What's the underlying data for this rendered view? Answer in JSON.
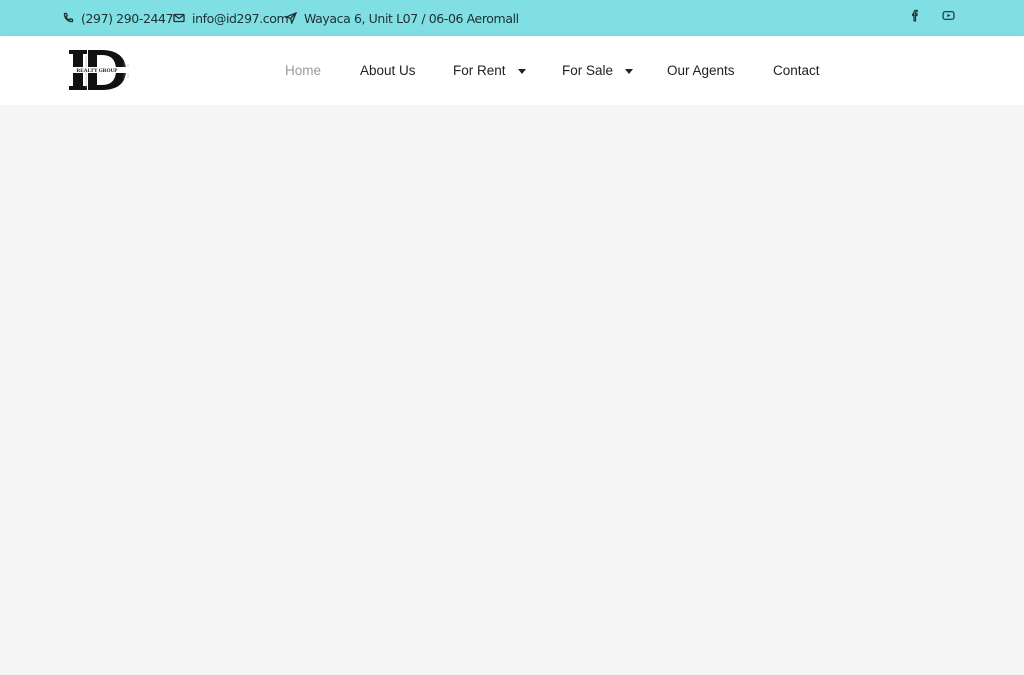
{
  "topbar": {
    "phone": "(297) 290-2447",
    "email": "info@id297.com",
    "address": "Wayaca 6, Unit L07 / 06-06 Aeromall",
    "social": [
      "facebook-icon",
      "youtube-icon"
    ],
    "background": "#7fdfe2"
  },
  "header": {
    "logo": {
      "letters": "ID",
      "tagline": "REALTY GROUP"
    },
    "nav": [
      {
        "label": "Home",
        "active": true
      },
      {
        "label": "About Us"
      },
      {
        "label": "For Rent",
        "dropdown": true
      },
      {
        "label": "For Sale",
        "dropdown": true
      },
      {
        "label": "Our Agents"
      },
      {
        "label": "Contact"
      }
    ]
  }
}
